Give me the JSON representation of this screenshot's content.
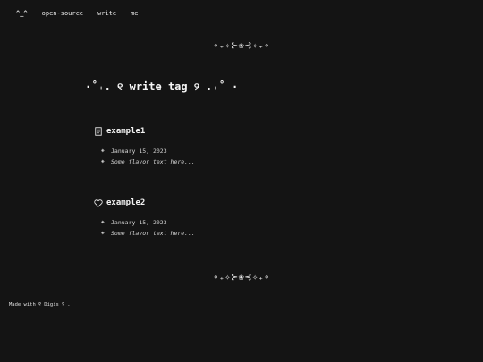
{
  "nav": {
    "home": "^_^",
    "items": [
      "open-source",
      "write",
      "me"
    ]
  },
  "divider": {
    "top": "∘₊✧⊱❀⊰✧₊∘",
    "bottom": "∘₊✧⊱❀⊰✧₊∘"
  },
  "page": {
    "title": "·˚₊. ୧ write tag ୨ .₊˚ ·"
  },
  "posts": [
    {
      "icon": "document-icon",
      "title": "example1",
      "date": "January 15, 2023",
      "flavor": "Some flavor text here..."
    },
    {
      "icon": "heart-icon",
      "title": "example2",
      "date": "January 15, 2023",
      "flavor": "Some flavor text here..."
    }
  ],
  "footer": {
    "prefix": "Made with ୧",
    "link_text": "Digis",
    "suffix": "୨ ."
  },
  "colors": {
    "background": "#141414",
    "text": "#f2f2f2"
  }
}
